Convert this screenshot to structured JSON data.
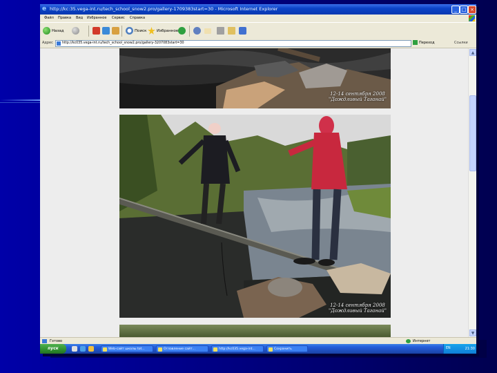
{
  "window": {
    "title": "http://kc:35.vega-int.ru/tech_school_snow2.pro/gallery-1709383start=30 - Microsoft Internet Explorer",
    "controls": [
      "_",
      "□",
      "×"
    ]
  },
  "menu": [
    "Файл",
    "Правка",
    "Вид",
    "Избранное",
    "Сервис",
    "Справка"
  ],
  "toolbar": {
    "back_label": "Назад",
    "search_label": "Поиск",
    "favorites_label": "Избранное"
  },
  "address": {
    "label": "Адрес",
    "url": "http://kc035.vega-int.ru/tech_school_snow2.pro/gallery-3207083start=30",
    "go_label": "Переход",
    "links_label": "Ссылки"
  },
  "photos": [
    {
      "caption_line1": "12-14 сентября 2008",
      "caption_line2": "\"Дождливый Таганай\""
    },
    {
      "caption_line1": "12-14 сентября 2008",
      "caption_line2": "\"Дождливый Таганай\""
    }
  ],
  "status": {
    "left": "Готово",
    "right": "Интернет"
  },
  "taskbar": {
    "start_label": "пуск",
    "items": [
      "Web-сайт школы tot...",
      "Оглавление сайт...",
      "http://kc035.vega-int...",
      "Сохранить"
    ],
    "lang": "EN",
    "clock": "21:30"
  },
  "colors": {
    "slide_bg": "#0000a8",
    "titlebar": "#0b43c8",
    "taskbar": "#245edb",
    "start_button": "#2f8f2f"
  }
}
